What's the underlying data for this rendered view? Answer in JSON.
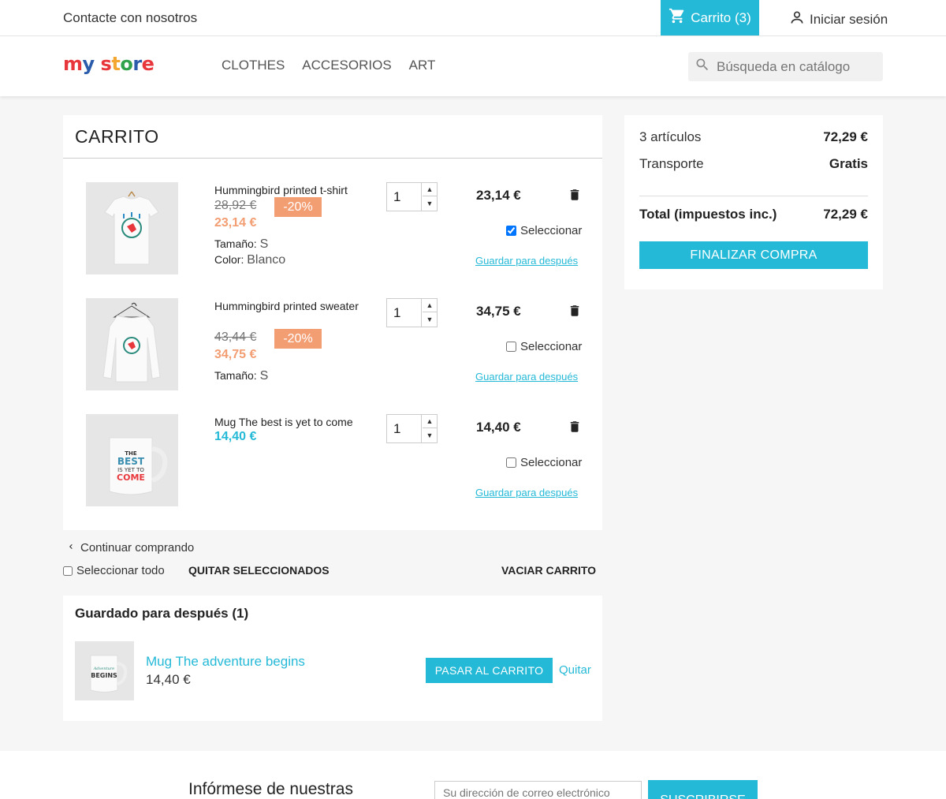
{
  "topbar": {
    "contact": "Contacte con nosotros",
    "cart_label": "Carrito (3)",
    "signin": "Iniciar sesión"
  },
  "header": {
    "logo": "my store",
    "nav": [
      "CLOTHES",
      "ACCESORIOS",
      "ART"
    ],
    "search_placeholder": "Búsqueda en catálogo"
  },
  "cart": {
    "title": "CARRITO",
    "items": [
      {
        "name": "Hummingbird printed t-shirt",
        "old_price": "28,92 €",
        "discount": "-20%",
        "price": "23,14 €",
        "attrs": [
          {
            "label": "Tamaño:",
            "value": "S"
          },
          {
            "label": "Color:",
            "value": "Blanco"
          }
        ],
        "quantity": "1",
        "line_total": "23,14 €",
        "select_label": "Seleccionar",
        "selected": true,
        "save_later": "Guardar para después"
      },
      {
        "name": "Hummingbird printed sweater",
        "old_price": "43,44 €",
        "discount": "-20%",
        "price": "34,75 €",
        "attrs": [
          {
            "label": "Tamaño:",
            "value": "S"
          }
        ],
        "quantity": "1",
        "line_total": "34,75 €",
        "select_label": "Seleccionar",
        "selected": false,
        "save_later": "Guardar para después"
      },
      {
        "name": "Mug The best is yet to come",
        "price": "14,40 €",
        "quantity": "1",
        "line_total": "14,40 €",
        "select_label": "Seleccionar",
        "selected": false,
        "save_later": "Guardar para después"
      }
    ],
    "continue": "Continuar comprando",
    "select_all": "Seleccionar todo",
    "remove_selected": "QUITAR SELECCIONADOS",
    "empty_cart": "VACIAR CARRITO"
  },
  "saved": {
    "title": "Guardado para después (1)",
    "item_name": "Mug The adventure begins",
    "item_price": "14,40 €",
    "to_cart": "PASAR AL CARRITO",
    "remove": "Quitar"
  },
  "summary": {
    "items_label": "3 artículos",
    "items_value": "72,29 €",
    "shipping_label": "Transporte",
    "shipping_value": "Gratis",
    "total_label": "Total (impuestos inc.)",
    "total_value": "72,29 €",
    "checkout": "FINALIZAR COMPRA"
  },
  "newsletter": {
    "text": "Infórmese de nuestras",
    "placeholder": "Su dirección de correo electrónico",
    "button": "SUSCRIBIRSE"
  },
  "colors": {
    "accent": "#24b9d7",
    "discount": "#f39d72"
  },
  "icons": [
    "cart-icon",
    "user-icon",
    "search-icon",
    "trash-icon",
    "chevron-left-icon",
    "chevron-up-icon",
    "chevron-down-icon"
  ]
}
